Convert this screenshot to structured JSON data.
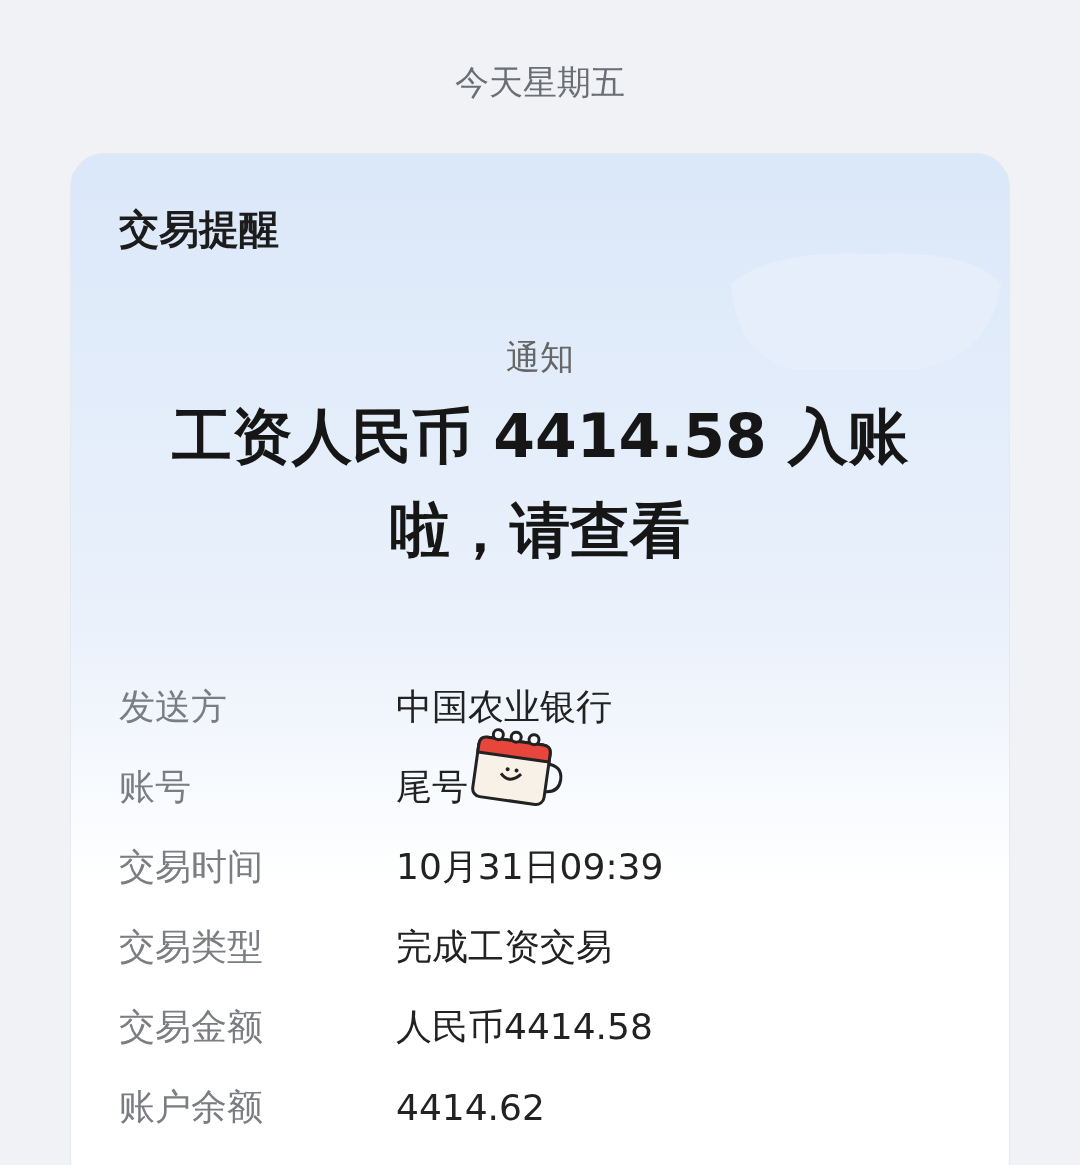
{
  "date_header": "今天星期五",
  "card": {
    "title": "交易提醒",
    "subtitle": "通知",
    "headline": "工资人民币 4414.58 入账啦，请查看",
    "details": [
      {
        "label": "发送方",
        "value": "中国农业银行"
      },
      {
        "label": "账号",
        "value": "尾号",
        "covered": true
      },
      {
        "label": "交易时间",
        "value": "10月31日09:39"
      },
      {
        "label": "交易类型",
        "value": "完成工资交易"
      },
      {
        "label": "交易金额",
        "value": "人民币4414.58"
      },
      {
        "label": "账户余额",
        "value": "4414.62"
      }
    ]
  }
}
